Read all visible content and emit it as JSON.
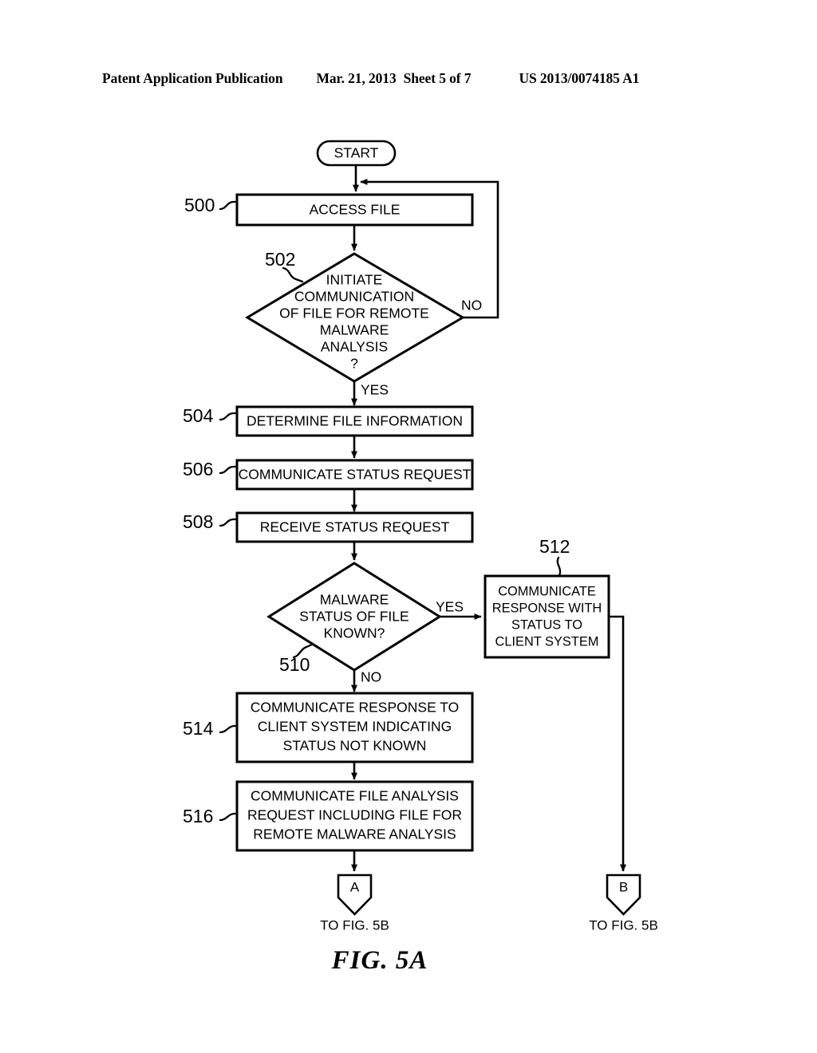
{
  "header": {
    "publication": "Patent Application Publication",
    "date": "Mar. 21, 2013",
    "sheet": "Sheet 5 of 7",
    "patent_number": "US 2013/0074185 A1"
  },
  "figure": {
    "caption": "FIG. 5A"
  },
  "flowchart": {
    "start": {
      "label": "START"
    },
    "nodes": [
      {
        "ref": "500",
        "type": "process",
        "lines": [
          "ACCESS FILE"
        ]
      },
      {
        "ref": "502",
        "type": "decision",
        "lines": [
          "INITIATE",
          "COMMUNICATION",
          "OF FILE FOR REMOTE",
          "MALWARE",
          "ANALYSIS",
          "?"
        ]
      },
      {
        "ref": "504",
        "type": "process",
        "lines": [
          "DETERMINE FILE INFORMATION"
        ]
      },
      {
        "ref": "506",
        "type": "process",
        "lines": [
          "COMMUNICATE STATUS REQUEST"
        ]
      },
      {
        "ref": "508",
        "type": "process",
        "lines": [
          "RECEIVE STATUS REQUEST"
        ]
      },
      {
        "ref": "510",
        "type": "decision",
        "lines": [
          "MALWARE",
          "STATUS OF FILE",
          "KNOWN?"
        ]
      },
      {
        "ref": "512",
        "type": "process",
        "lines": [
          "COMMUNICATE",
          "RESPONSE WITH",
          "STATUS TO",
          "CLIENT SYSTEM"
        ]
      },
      {
        "ref": "514",
        "type": "process",
        "lines": [
          "COMMUNICATE RESPONSE TO",
          "CLIENT SYSTEM INDICATING",
          "STATUS NOT KNOWN"
        ]
      },
      {
        "ref": "516",
        "type": "process",
        "lines": [
          "COMMUNICATE FILE ANALYSIS",
          "REQUEST INCLUDING FILE  FOR",
          "REMOTE MALWARE ANALYSIS"
        ]
      }
    ],
    "edge_labels": {
      "d502_no": "NO",
      "d502_yes": "YES",
      "d510_yes": "YES",
      "d510_no": "NO"
    },
    "connectors": [
      {
        "letter": "A",
        "caption": "TO FIG. 5B"
      },
      {
        "letter": "B",
        "caption": "TO FIG. 5B"
      }
    ]
  }
}
